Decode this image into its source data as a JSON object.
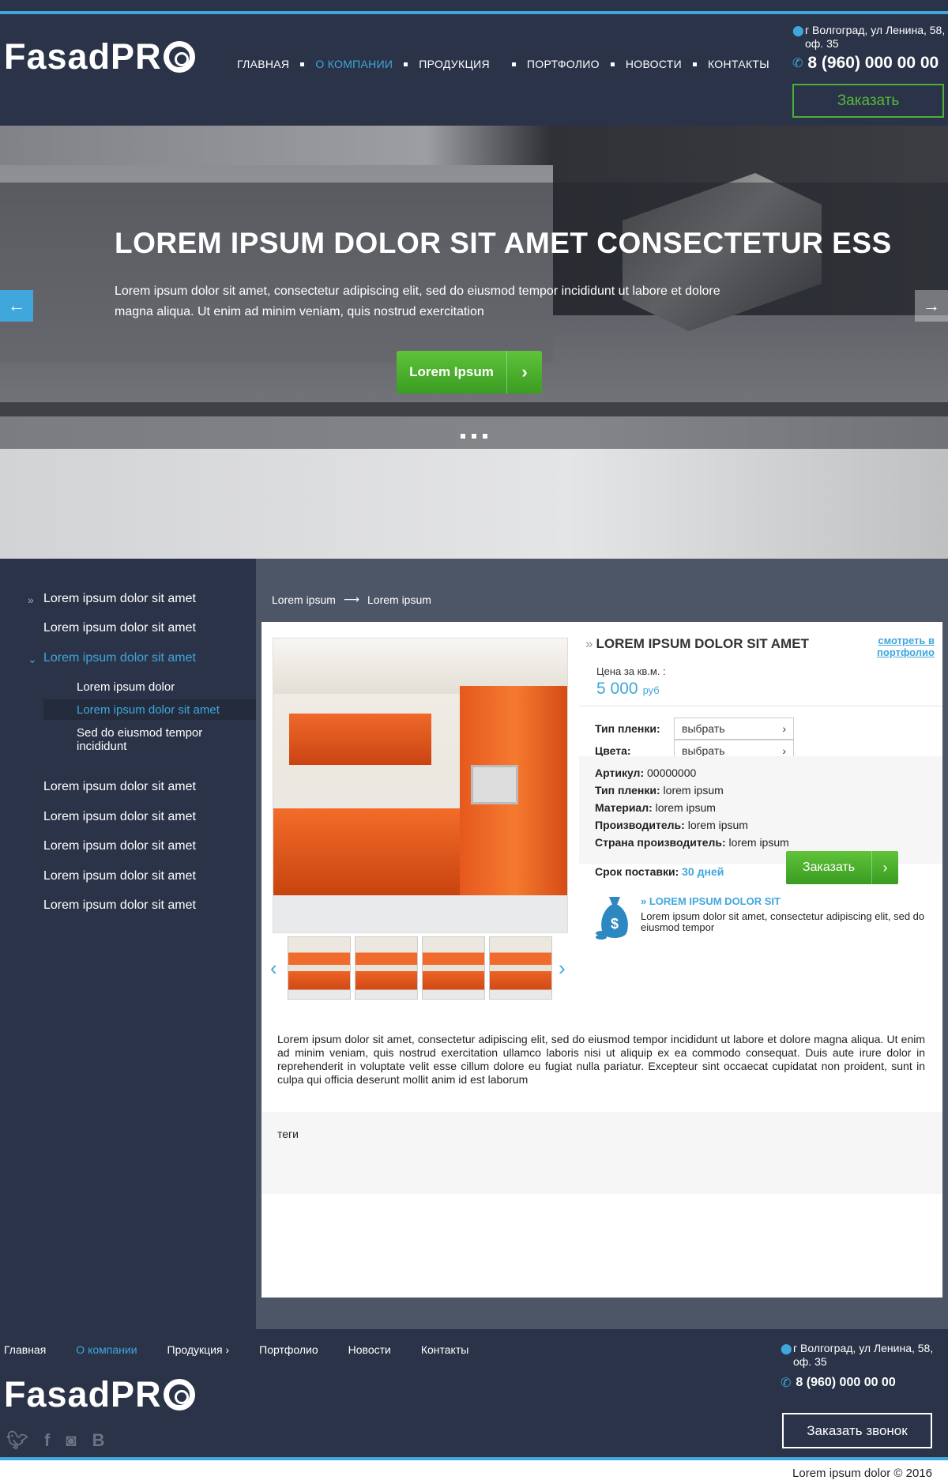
{
  "header": {
    "logo": "FasadPR",
    "nav": [
      "ГЛАВНАЯ",
      "О КОМПАНИИ",
      "ПРОДУКЦИЯ",
      "ПОРТФОЛИО",
      "НОВОСТИ",
      "КОНТАКТЫ"
    ],
    "address": "г Волгоград, ул Ленина, 58, оф. 35",
    "phone": "8 (960) 000 00 00",
    "order_button": "Заказать"
  },
  "hero": {
    "title": "LOREM IPSUM DOLOR SIT AMET CONSECTETUR ESS",
    "text": "Lorem ipsum dolor sit amet, consectetur adipiscing elit, sed do eiusmod tempor incididunt ut labore et dolore magna aliqua. Ut enim ad minim veniam, quis nostrud exercitation",
    "cta": "Lorem Ipsum",
    "prev_icon": "arrow-left-icon",
    "next_icon": "arrow-right-icon"
  },
  "sidebar": {
    "items": [
      "Lorem ipsum dolor sit amet",
      "Lorem ipsum dolor sit amet",
      "Lorem ipsum dolor sit amet"
    ],
    "sub": [
      "Lorem ipsum dolor",
      "Lorem ipsum dolor sit amet",
      "Sed do eiusmod tempor incididunt"
    ],
    "more": [
      "Lorem ipsum dolor sit amet",
      "Lorem ipsum dolor sit amet",
      "Lorem ipsum dolor sit amet",
      "Lorem ipsum dolor sit amet",
      "Lorem ipsum dolor sit amet"
    ]
  },
  "breadcrumb": [
    "Lorem ipsum",
    "Lorem ipsum"
  ],
  "product": {
    "title": "LOREM IPSUM DOLOR SIT AMET",
    "see_portfolio": "смотреть в портфолио",
    "price_label": "Цена за кв.м. :",
    "price": "5 000",
    "currency": "руб",
    "film_label": "Тип пленки:",
    "color_label": "Цвета:",
    "select_placeholder": "выбрать",
    "specs": [
      {
        "k": "Артикул:",
        "v": "00000000"
      },
      {
        "k": "Тип пленки:",
        "v": "lorem ipsum"
      },
      {
        "k": "Материал:",
        "v": "lorem ipsum"
      },
      {
        "k": "Производитель:",
        "v": "lorem ipsum"
      },
      {
        "k": "Страна производитель:",
        "v": "lorem ipsum"
      }
    ],
    "delivery_label": "Срок поставки:",
    "delivery_value": "30 дней",
    "order_button": "Заказать",
    "pay_title": "LOREM IPSUM DOLOR SIT",
    "pay_text": "Lorem ipsum dolor sit amet, consectetur adipiscing elit, sed do eiusmod tempor",
    "description": "Lorem ipsum dolor sit amet, consectetur adipiscing elit, sed do eiusmod tempor incididunt ut labore et dolore magna aliqua. Ut enim ad minim veniam, quis nostrud exercitation ullamco laboris nisi ut aliquip ex ea commodo consequat. Duis aute irure dolor in reprehenderit in voluptate velit esse cillum dolore eu fugiat nulla pariatur. Excepteur sint occaecat cupidatat non proident, sunt in culpa qui officia deserunt mollit anim id est laborum",
    "tags_label": "теги"
  },
  "footer": {
    "nav": [
      "Главная",
      "О компании",
      "Продукция",
      "Портфолио",
      "Новости",
      "Контакты"
    ],
    "address": "г Волгоград, ул Ленина, 58, оф. 35",
    "phone": "8 (960) 000 00 00",
    "callback_button": "Заказать звонок",
    "copyright": "Lorem ipsum dolor © 2016"
  },
  "colors": {
    "accent": "#3fa7dc",
    "green": "#4caf3a",
    "dark": "#2a3347"
  }
}
